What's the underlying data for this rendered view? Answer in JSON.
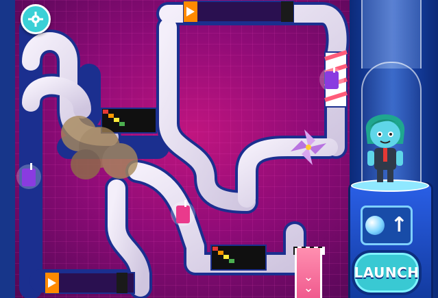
{
  "game": {
    "launch_label": "LAUNCH",
    "settings_icon": "gear-icon",
    "booster_icon": "bubble-arrow-up-icon",
    "exit_icon": "double-chevron-down-icon"
  },
  "colors": {
    "board_magenta": "#c0157f",
    "pipe_fill": "#e7dff0",
    "pipe_border": "#1b2f8f",
    "panel_blue": "#1b4cbc",
    "launch_teal": "#39c9d3"
  },
  "items": {
    "juice_boxes": [
      "purple-juice-box",
      "purple-juice-box",
      "pink-juice-box"
    ],
    "hazards": [
      "pinwheel-fan",
      "dust-cloud",
      "color-ladder",
      "color-ladder"
    ]
  }
}
